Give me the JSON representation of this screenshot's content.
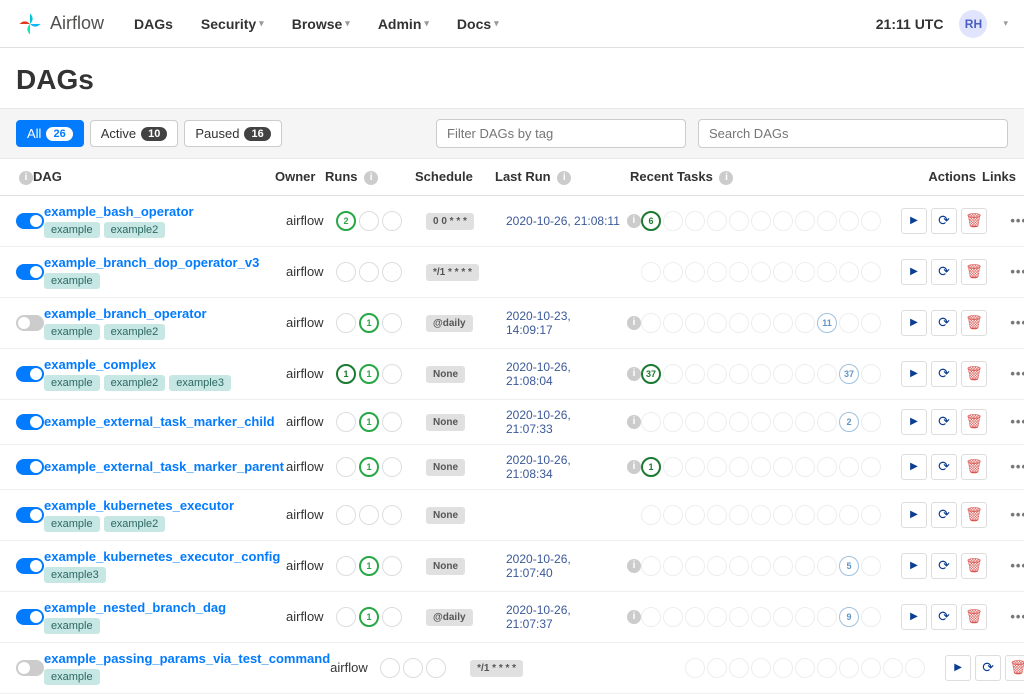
{
  "app": {
    "name": "Airflow"
  },
  "nav": {
    "items": [
      "DAGs",
      "Security",
      "Browse",
      "Admin",
      "Docs"
    ],
    "time": "21:11 UTC",
    "user_initials": "RH"
  },
  "page": {
    "title": "DAGs"
  },
  "filters": {
    "all": {
      "label": "All",
      "count": "26"
    },
    "active": {
      "label": "Active",
      "count": "10"
    },
    "paused": {
      "label": "Paused",
      "count": "16"
    },
    "tag_placeholder": "Filter DAGs by tag",
    "search_placeholder": "Search DAGs"
  },
  "columns": {
    "dag": "DAG",
    "owner": "Owner",
    "runs": "Runs",
    "schedule": "Schedule",
    "lastrun": "Last Run",
    "tasks": "Recent Tasks",
    "actions": "Actions",
    "links": "Links"
  },
  "rows": [
    {
      "on": true,
      "name": "example_bash_operator",
      "tags": [
        "example",
        "example2"
      ],
      "owner": "airflow",
      "runs": [
        {
          "v": "2",
          "c": "green"
        },
        {
          "v": "",
          "c": ""
        },
        {
          "v": "",
          "c": ""
        }
      ],
      "schedule": "0 0 * * *",
      "lastrun": "2020-10-26, 21:08:11",
      "task": {
        "v": "6",
        "c": "done",
        "pos": 0
      },
      "blue": null
    },
    {
      "on": true,
      "name": "example_branch_dop_operator_v3",
      "tags": [
        "example"
      ],
      "owner": "airflow",
      "runs": [
        {
          "v": "",
          "c": ""
        },
        {
          "v": "",
          "c": ""
        },
        {
          "v": "",
          "c": ""
        }
      ],
      "schedule": "*/1 * * * *",
      "lastrun": "",
      "task": null,
      "blue": null
    },
    {
      "on": false,
      "name": "example_branch_operator",
      "tags": [
        "example",
        "example2"
      ],
      "owner": "airflow",
      "runs": [
        {
          "v": "",
          "c": ""
        },
        {
          "v": "1",
          "c": "green"
        },
        {
          "v": "",
          "c": ""
        }
      ],
      "schedule": "@daily",
      "lastrun": "2020-10-23, 14:09:17",
      "task": null,
      "blue": {
        "v": "11",
        "pos": 8
      }
    },
    {
      "on": true,
      "name": "example_complex",
      "tags": [
        "example",
        "example2",
        "example3"
      ],
      "owner": "airflow",
      "runs": [
        {
          "v": "1",
          "c": "greenThick"
        },
        {
          "v": "1",
          "c": "green"
        },
        {
          "v": "",
          "c": ""
        }
      ],
      "schedule": "None",
      "lastrun": "2020-10-26, 21:08:04",
      "task": {
        "v": "37",
        "c": "done",
        "pos": 0
      },
      "blue": {
        "v": "37",
        "pos": 9
      }
    },
    {
      "on": true,
      "name": "example_external_task_marker_child",
      "tags": [],
      "owner": "airflow",
      "runs": [
        {
          "v": "",
          "c": ""
        },
        {
          "v": "1",
          "c": "green"
        },
        {
          "v": "",
          "c": ""
        }
      ],
      "schedule": "None",
      "lastrun": "2020-10-26, 21:07:33",
      "task": null,
      "blue": {
        "v": "2",
        "pos": 9
      }
    },
    {
      "on": true,
      "name": "example_external_task_marker_parent",
      "tags": [],
      "owner": "airflow",
      "runs": [
        {
          "v": "",
          "c": ""
        },
        {
          "v": "1",
          "c": "green"
        },
        {
          "v": "",
          "c": ""
        }
      ],
      "schedule": "None",
      "lastrun": "2020-10-26, 21:08:34",
      "task": {
        "v": "1",
        "c": "done",
        "pos": 0
      },
      "blue": null
    },
    {
      "on": true,
      "name": "example_kubernetes_executor",
      "tags": [
        "example",
        "example2"
      ],
      "owner": "airflow",
      "runs": [
        {
          "v": "",
          "c": ""
        },
        {
          "v": "",
          "c": ""
        },
        {
          "v": "",
          "c": ""
        }
      ],
      "schedule": "None",
      "lastrun": "",
      "task": null,
      "blue": null
    },
    {
      "on": true,
      "name": "example_kubernetes_executor_config",
      "tags": [
        "example3"
      ],
      "owner": "airflow",
      "runs": [
        {
          "v": "",
          "c": ""
        },
        {
          "v": "1",
          "c": "green"
        },
        {
          "v": "",
          "c": ""
        }
      ],
      "schedule": "None",
      "lastrun": "2020-10-26, 21:07:40",
      "task": null,
      "blue": {
        "v": "5",
        "pos": 9
      }
    },
    {
      "on": true,
      "name": "example_nested_branch_dag",
      "tags": [
        "example"
      ],
      "owner": "airflow",
      "runs": [
        {
          "v": "",
          "c": ""
        },
        {
          "v": "1",
          "c": "green"
        },
        {
          "v": "",
          "c": ""
        }
      ],
      "schedule": "@daily",
      "lastrun": "2020-10-26, 21:07:37",
      "task": null,
      "blue": {
        "v": "9",
        "pos": 9
      }
    },
    {
      "on": false,
      "name": "example_passing_params_via_test_command",
      "tags": [
        "example"
      ],
      "owner": "airflow",
      "runs": [
        {
          "v": "",
          "c": ""
        },
        {
          "v": "",
          "c": ""
        },
        {
          "v": "",
          "c": ""
        }
      ],
      "schedule": "*/1 * * * *",
      "lastrun": "",
      "task": null,
      "blue": null
    }
  ]
}
